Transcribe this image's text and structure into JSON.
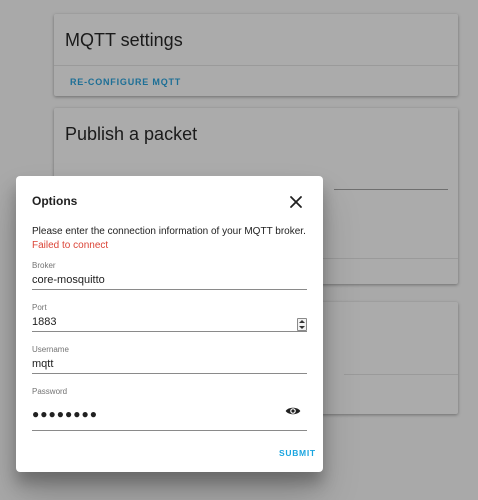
{
  "background": {
    "mqtt_card": {
      "title": "MQTT settings",
      "action_label": "RE-CONFIGURE MQTT"
    },
    "publish_card": {
      "title": "Publish a packet"
    }
  },
  "dialog": {
    "title": "Options",
    "close_icon": "close-icon",
    "description": "Please enter the connection information of your MQTT broker.",
    "error": "Failed to connect",
    "fields": {
      "broker": {
        "label": "Broker",
        "value": "core-mosquitto"
      },
      "port": {
        "label": "Port",
        "value": "1883"
      },
      "username": {
        "label": "Username",
        "value": "mqtt"
      },
      "password": {
        "label": "Password",
        "value": "●●●●●●●●",
        "toggle_icon": "eye-icon"
      }
    },
    "submit_label": "SUBMIT"
  },
  "colors": {
    "accent": "#1aa5e0",
    "error": "#db4437",
    "link": "#1d6f96",
    "scrim_background": "#a9a9a9"
  }
}
